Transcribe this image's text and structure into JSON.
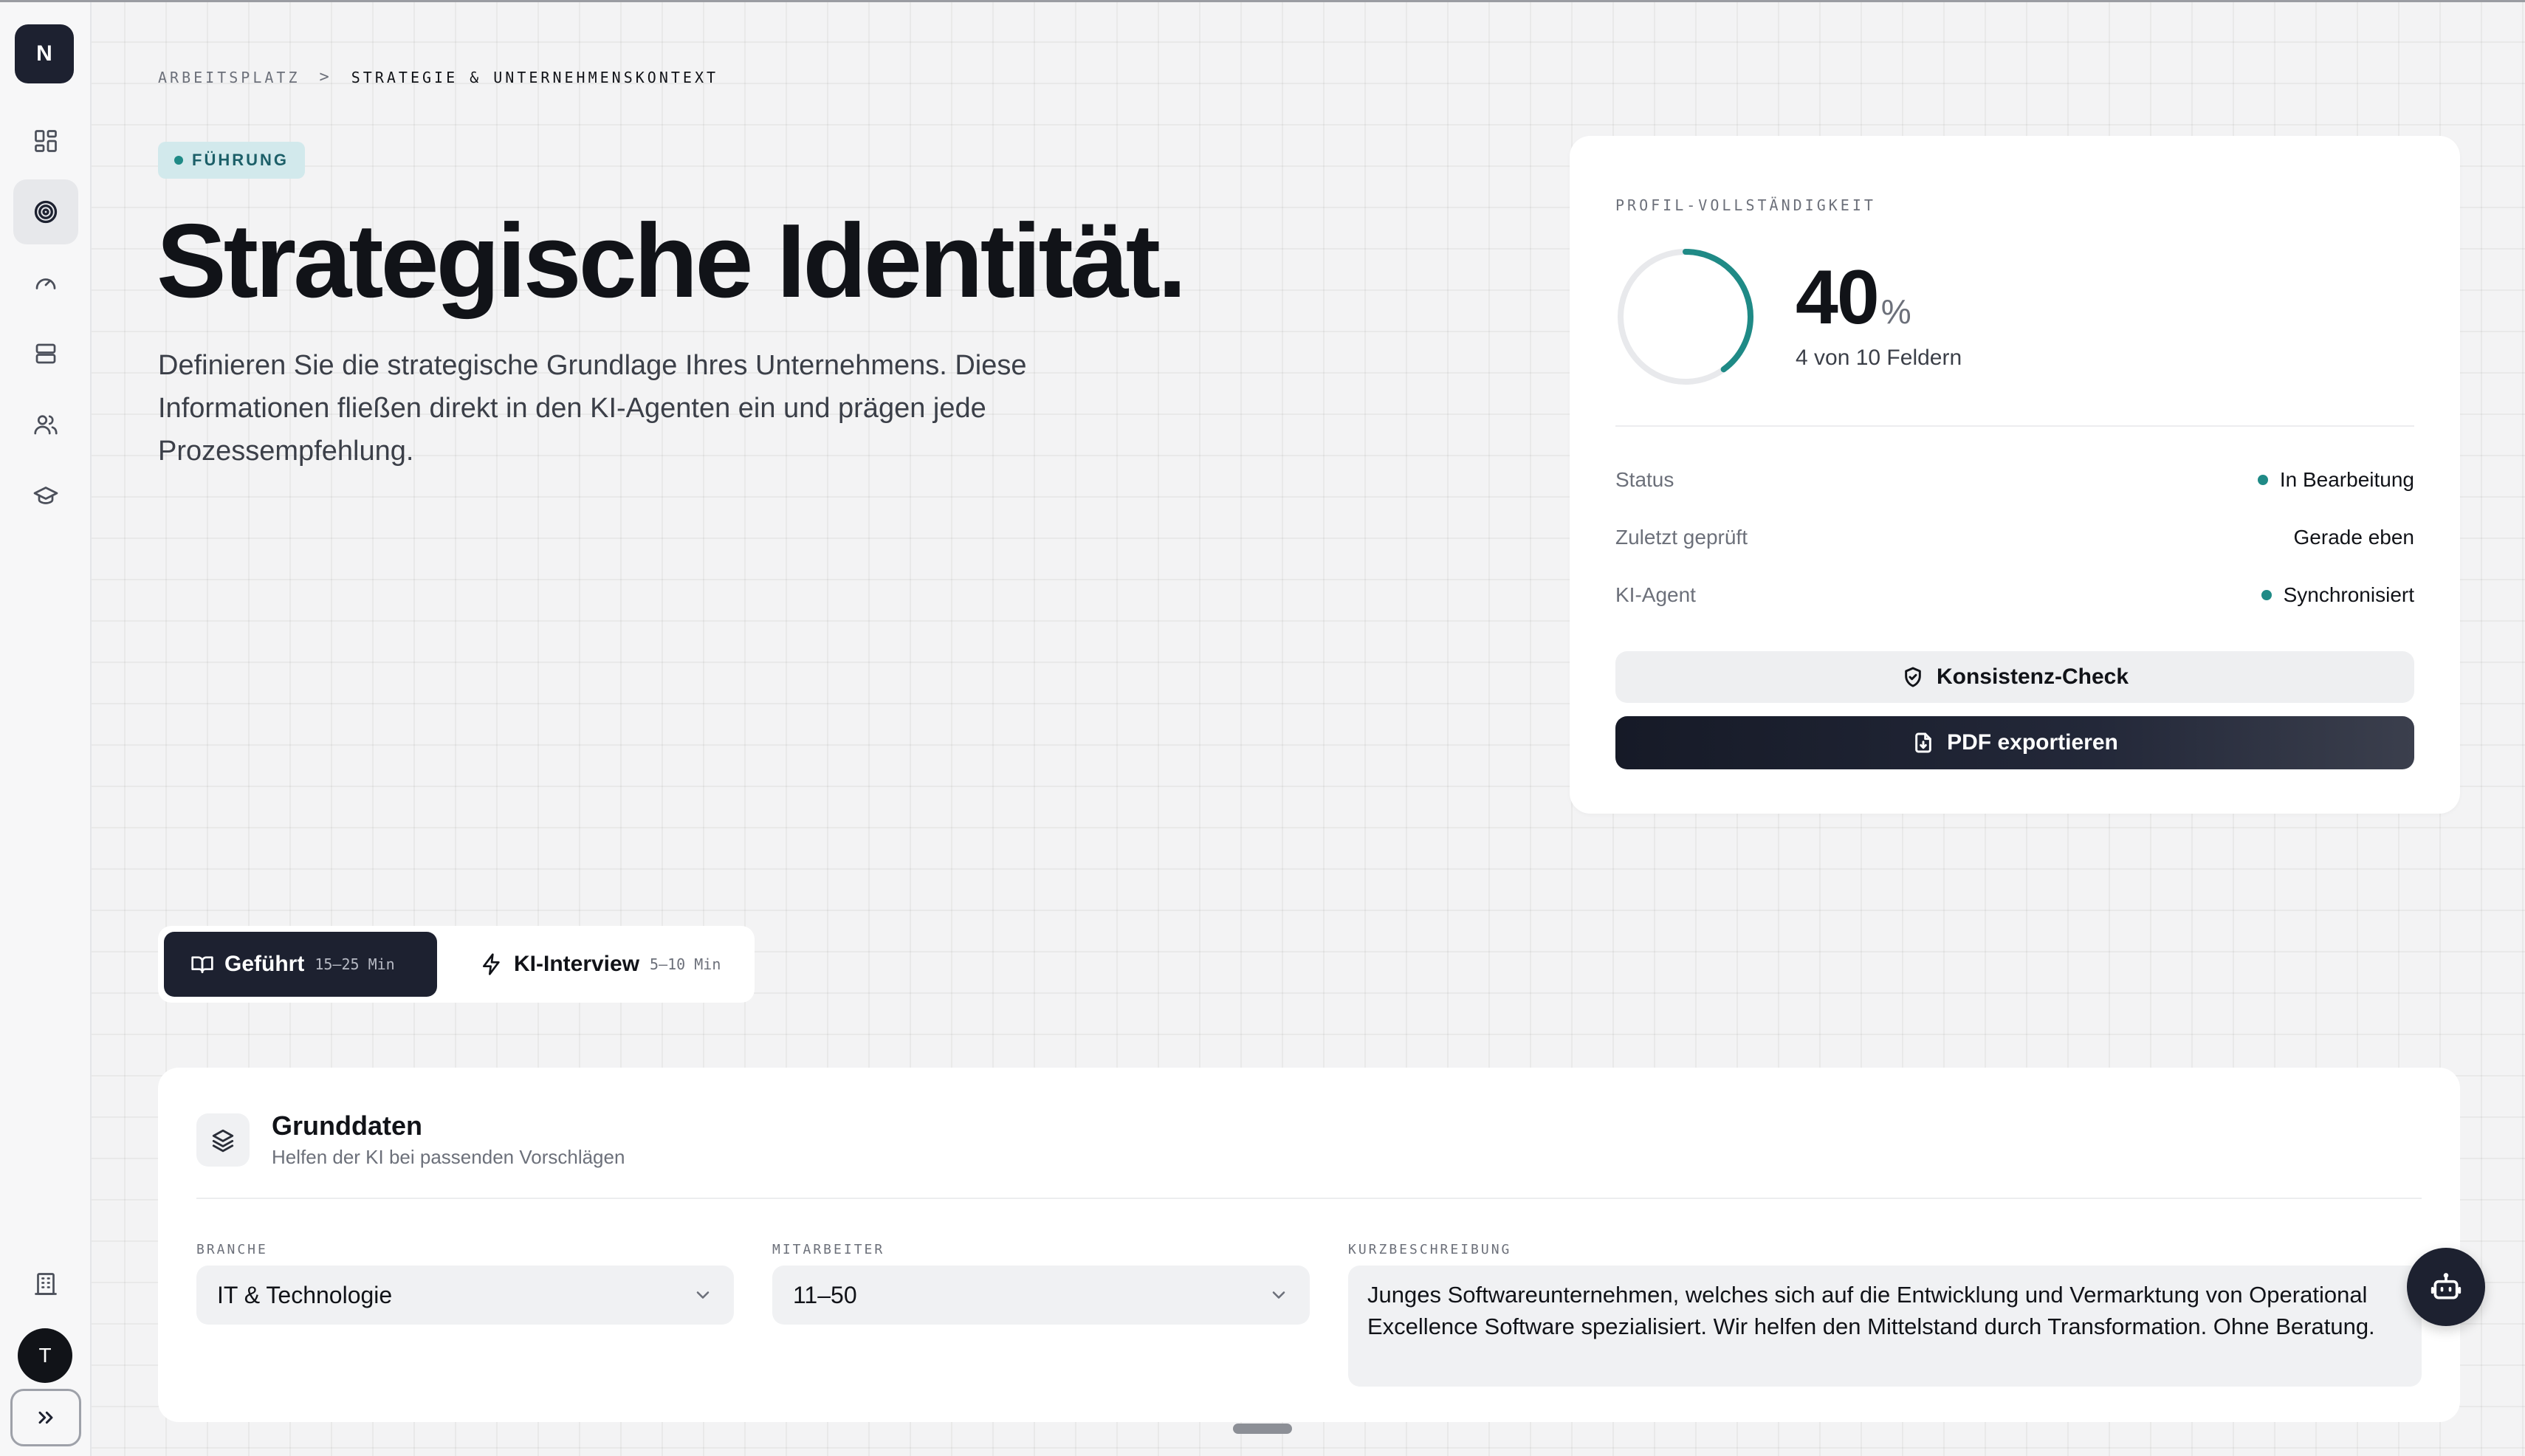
{
  "sidebar": {
    "logo_letter": "N",
    "nav_icons": [
      "dashboard-icon",
      "target-icon",
      "gauge-icon",
      "layers-icon",
      "users-icon",
      "graduation-cap-icon"
    ],
    "active_icon": "target-icon",
    "footer_icon": "building-icon",
    "avatar_letter": "T",
    "expand_icon": "chevrons-right-icon"
  },
  "breadcrumb": {
    "parent": "ARBEITSPLATZ",
    "separator": ">",
    "current": "STRATEGIE & UNTERNEHMENSKONTEXT"
  },
  "header": {
    "badge": "FÜHRUNG",
    "title": "Strategische Identität.",
    "description": "Definieren Sie die strategische Grundlage Ihres Unternehmens. Diese Informationen fließen direkt in den KI-Agenten ein und prägen jede Prozessempfehlung."
  },
  "profile": {
    "label": "PROFIL-VOLLSTÄNDIGKEIT",
    "percent": "40",
    "percent_unit": "%",
    "progress_fraction": 0.4,
    "fields_text": "4 von 10 Feldern",
    "rows": [
      {
        "key": "Status",
        "value": "In Bearbeitung",
        "dot": true
      },
      {
        "key": "Zuletzt geprüft",
        "value": "Gerade eben",
        "dot": false
      },
      {
        "key": "KI-Agent",
        "value": "Synchronisiert",
        "dot": true
      }
    ],
    "check_button": "Konsistenz-Check",
    "pdf_button": "PDF exportieren"
  },
  "mode_tabs": [
    {
      "label": "Geführt",
      "time": "15–25 Min",
      "icon": "book-icon",
      "active": true
    },
    {
      "label": "KI-Interview",
      "time": "5–10 Min",
      "icon": "lightning-icon",
      "active": false
    }
  ],
  "section": {
    "icon": "layers-icon",
    "title": "Grunddaten",
    "subtitle": "Helfen der KI bei passenden Vorschlägen",
    "fields": {
      "branche": {
        "label": "BRANCHE",
        "value": "IT & Technologie"
      },
      "mitarbeiter": {
        "label": "MITARBEITER",
        "value": "11–50"
      },
      "kurzbeschreibung": {
        "label": "KURZBESCHREIBUNG",
        "value": "Junges Softwareunternehmen, welches sich auf die Entwicklung und Vermarktung von Operational Excellence Software spezialisiert. Wir helfen den Mittelstand durch Transformation. Ohne Beratung."
      }
    }
  },
  "colors": {
    "accent": "#1f8a86",
    "dark": "#1d2130",
    "badge_bg": "#d2e9ec"
  }
}
